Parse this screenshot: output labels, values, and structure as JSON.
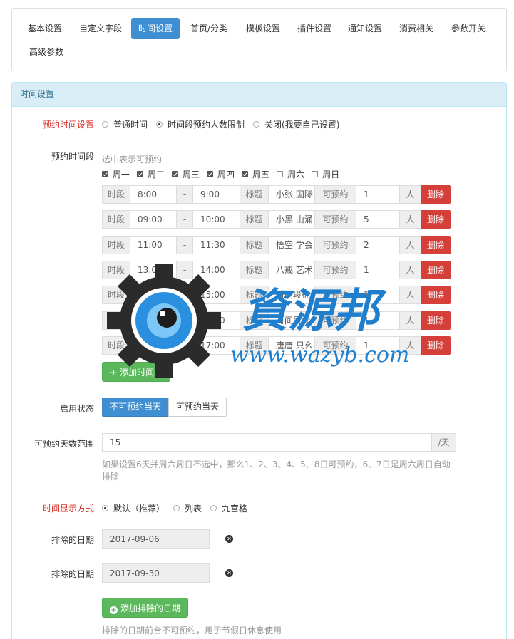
{
  "tabs": [
    {
      "label": "基本设置",
      "active": false
    },
    {
      "label": "自定义字段",
      "active": false
    },
    {
      "label": "时间设置",
      "active": true
    },
    {
      "label": "首页/分类",
      "active": false
    },
    {
      "label": "模板设置",
      "active": false
    },
    {
      "label": "插件设置",
      "active": false
    },
    {
      "label": "通知设置",
      "active": false
    },
    {
      "label": "消费相关",
      "active": false
    },
    {
      "label": "参数开关",
      "active": false
    },
    {
      "label": "高级参数",
      "active": false
    }
  ],
  "panel": {
    "title": "时间设置"
  },
  "booking_mode": {
    "label": "预约时间设置",
    "options": [
      {
        "label": "普通时间",
        "checked": false
      },
      {
        "label": "时间段预约人数限制",
        "checked": true
      },
      {
        "label": "关闭(我要自己设置)",
        "checked": false
      }
    ]
  },
  "periods": {
    "label": "预约时间段",
    "hint": "选中表示可预约",
    "weekdays": [
      {
        "label": "周一",
        "checked": true
      },
      {
        "label": "周二",
        "checked": true
      },
      {
        "label": "周三",
        "checked": true
      },
      {
        "label": "周四",
        "checked": true
      },
      {
        "label": "周五",
        "checked": true
      },
      {
        "label": "周六",
        "checked": false
      },
      {
        "label": "周日",
        "checked": false
      }
    ],
    "labels": {
      "period": "时段",
      "dash": "-",
      "title": "标题",
      "available": "可预约",
      "unit": "人",
      "delete": "删除"
    },
    "rows": [
      {
        "start": "8:00",
        "end": "9:00",
        "title": "小张 国际",
        "count": "1"
      },
      {
        "start": "09:00",
        "end": "10:00",
        "title": "小黑 山涌",
        "count": "5"
      },
      {
        "start": "11:00",
        "end": "11:30",
        "title": "悟空 学会",
        "count": "2"
      },
      {
        "start": "13:00",
        "end": "14:00",
        "title": "八戒 艺术",
        "count": "1"
      },
      {
        "start": "14:00",
        "end": "15:00",
        "title": "时间段标",
        "count": "1"
      },
      {
        "start": "15:00",
        "end": "16:00",
        "title": "时间段标",
        "count": "1"
      },
      {
        "start": "16:00",
        "end": "17:00",
        "title": "唐唐 只幺",
        "count": "1"
      }
    ],
    "add_button": "添加时间段"
  },
  "status": {
    "label": "启用状态",
    "options": [
      {
        "label": "不可预约当天",
        "active": true
      },
      {
        "label": "可预约当天",
        "active": false
      }
    ]
  },
  "days_range": {
    "label": "可预约天数范围",
    "value": "15",
    "suffix": "/天",
    "help": "如果设置6天并周六周日不选中，那么1、2、3、4、5、8日可预约，6、7日是周六周日自动排除"
  },
  "display_mode": {
    "label": "时间显示方式",
    "options": [
      {
        "label": "默认（推荐）",
        "checked": true
      },
      {
        "label": "列表",
        "checked": false
      },
      {
        "label": "九宫格",
        "checked": false
      }
    ]
  },
  "excluded_dates": {
    "label": "排除的日期",
    "dates": [
      "2017-09-06",
      "2017-09-30"
    ],
    "add_button": "添加排除的日期",
    "help": "排除的日期前台不可预约，用于节假日休息使用"
  },
  "watermark": {
    "name": "資源邦",
    "url": "www.wazyb.com"
  },
  "colors": {
    "primary": "#3d8fd1",
    "danger": "#d43f3a",
    "success": "#5cb85c",
    "required": "#d9322b"
  }
}
